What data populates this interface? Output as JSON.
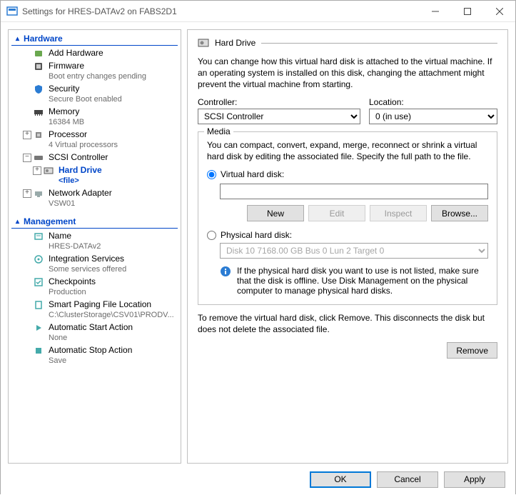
{
  "window": {
    "title": "Settings for HRES-DATAv2 on FABS2D1"
  },
  "sidebar": {
    "hardware_header": "Hardware",
    "management_header": "Management",
    "items": [
      {
        "label": "Add Hardware",
        "sub": ""
      },
      {
        "label": "Firmware",
        "sub": "Boot entry changes pending"
      },
      {
        "label": "Security",
        "sub": "Secure Boot enabled"
      },
      {
        "label": "Memory",
        "sub": "16384 MB"
      },
      {
        "label": "Processor",
        "sub": "4 Virtual processors"
      },
      {
        "label": "SCSI Controller",
        "sub": ""
      },
      {
        "label": "Hard Drive",
        "sub": "<file>"
      },
      {
        "label": "Network Adapter",
        "sub": "VSW01"
      }
    ],
    "mgmt": [
      {
        "label": "Name",
        "sub": "HRES-DATAv2"
      },
      {
        "label": "Integration Services",
        "sub": "Some services offered"
      },
      {
        "label": "Checkpoints",
        "sub": "Production"
      },
      {
        "label": "Smart Paging File Location",
        "sub": "C:\\ClusterStorage\\CSV01\\PRODV..."
      },
      {
        "label": "Automatic Start Action",
        "sub": "None"
      },
      {
        "label": "Automatic Stop Action",
        "sub": "Save"
      }
    ]
  },
  "main": {
    "heading": "Hard Drive",
    "intro": "You can change how this virtual hard disk is attached to the virtual machine. If an operating system is installed on this disk, changing the attachment might prevent the virtual machine from starting.",
    "controller_label": "Controller:",
    "location_label": "Location:",
    "controller_value": "SCSI Controller",
    "location_value": "0 (in use)",
    "media_legend": "Media",
    "media_desc": "You can compact, convert, expand, merge, reconnect or shrink a virtual hard disk by editing the associated file. Specify the full path to the file.",
    "vhd_label": "Virtual hard disk:",
    "vhd_value": "",
    "btn_new": "New",
    "btn_edit": "Edit",
    "btn_inspect": "Inspect",
    "btn_browse": "Browse...",
    "phd_label": "Physical hard disk:",
    "phd_value": "Disk 10 7168.00 GB Bus 0 Lun 2 Target 0",
    "phd_info": "If the physical hard disk you want to use is not listed, make sure that the disk is offline. Use Disk Management on the physical computer to manage physical hard disks.",
    "remove_desc": "To remove the virtual hard disk, click Remove. This disconnects the disk but does not delete the associated file.",
    "btn_remove": "Remove"
  },
  "footer": {
    "ok": "OK",
    "cancel": "Cancel",
    "apply": "Apply"
  }
}
